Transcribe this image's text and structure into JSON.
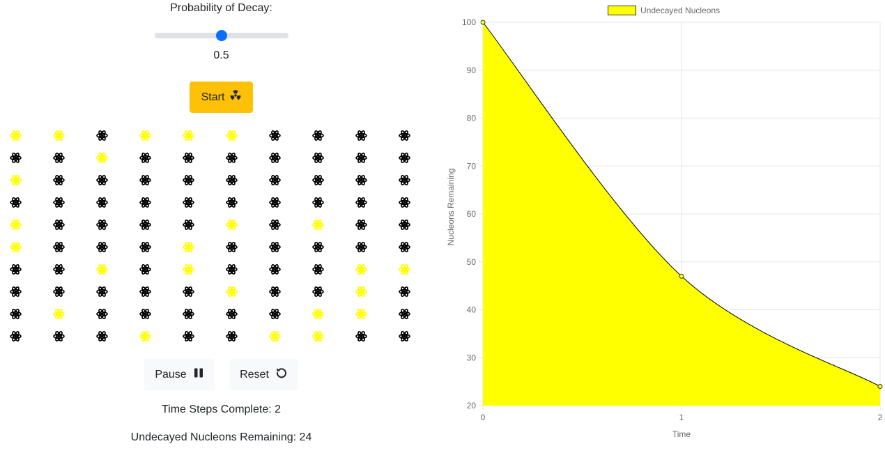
{
  "controls": {
    "probability_label": "Probability of Decay:",
    "probability_value": "0.5",
    "slider": {
      "min": 0,
      "max": 1,
      "value": 0.5
    },
    "start_label": "Start",
    "pause_label": "Pause",
    "reset_label": "Reset"
  },
  "status": {
    "steps_text": "Time Steps Complete: 2",
    "remaining_text": "Undecayed Nucleons Remaining: 24"
  },
  "icons": {
    "start": "radioactive-icon",
    "pause": "pause-icon",
    "reset": "reset-icon",
    "nucleus": "atom-icon"
  },
  "colors": {
    "accent_yellow": "#ffc107",
    "slider_blue": "#0d6efd",
    "undecayed": "#000000",
    "decayed": "#ffff00",
    "chart_fill": "#ffff00",
    "chart_line": "#000000"
  },
  "nucleons": {
    "rows": 10,
    "cols": 10,
    "states": [
      "DDUDDDUUUU",
      "UUDUUUUUUU",
      "DUUUUUUUUU",
      "UUUUUUUUUU",
      "DUUUUDUDUU",
      "DUUUDUUUUU",
      "UUDUDUUUDD",
      "UUUUUDUUDU",
      "UDUUUUUDDU",
      "UUUDUUDDUU"
    ]
  },
  "chart_data": {
    "type": "area",
    "x": [
      0,
      1,
      2
    ],
    "series": [
      {
        "name": "Undecayed Nucleons",
        "values": [
          100,
          47,
          24
        ]
      }
    ],
    "xlabel": "Time",
    "ylabel": "Nucleons Remaining",
    "xticks": [
      "0",
      "1",
      "2"
    ],
    "yticks": [
      20,
      30,
      40,
      50,
      60,
      70,
      80,
      90,
      100
    ],
    "xlim": [
      0,
      2
    ],
    "ylim": [
      20,
      100
    ],
    "grid": true,
    "legend": "top"
  }
}
